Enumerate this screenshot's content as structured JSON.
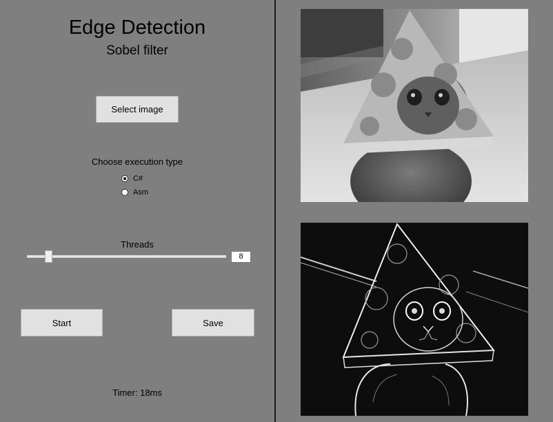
{
  "app": {
    "title": "Edge Detection",
    "subtitle": "Sobel filter"
  },
  "controls": {
    "select_image_label": "Select image",
    "execution_type_label": "Choose execution type",
    "execution_options": [
      {
        "label": "C#",
        "selected": true
      },
      {
        "label": "Asm",
        "selected": false
      }
    ],
    "threads_label": "Threads",
    "threads_value": "8",
    "threads_slider_value": 8,
    "start_label": "Start",
    "save_label": "Save",
    "timer_text": "Timer: 18ms"
  },
  "images": {
    "source_icon": "cat-with-pizza-hat-grayscale",
    "result_icon": "cat-with-pizza-hat-sobel-edges"
  },
  "colors": {
    "panel_background": "#7f7f7f",
    "button_background": "#e1e1e1",
    "divider": "#1a1a1a"
  }
}
